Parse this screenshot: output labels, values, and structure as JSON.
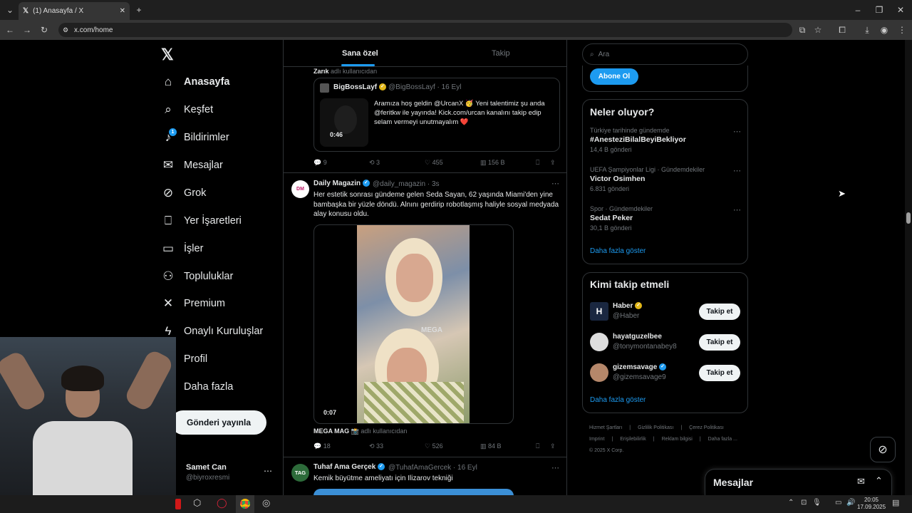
{
  "browser": {
    "tab_title": "(1) Anasayfa / X",
    "url": "x.com/home"
  },
  "sidebar": {
    "logo": "X",
    "items": [
      {
        "label": "Anasayfa",
        "icon": "home-icon",
        "glyph": "⌂"
      },
      {
        "label": "Keşfet",
        "icon": "search-icon",
        "glyph": "⌕"
      },
      {
        "label": "Bildirimler",
        "icon": "bell-icon",
        "glyph": "♪",
        "badge": "1"
      },
      {
        "label": "Mesajlar",
        "icon": "mail-icon",
        "glyph": "✉"
      },
      {
        "label": "Grok",
        "icon": "grok-icon",
        "glyph": "⊘"
      },
      {
        "label": "Yer İşaretleri",
        "icon": "bookmark-icon",
        "glyph": "⎕"
      },
      {
        "label": "İşler",
        "icon": "briefcase-icon",
        "glyph": "▭"
      },
      {
        "label": "Topluluklar",
        "icon": "communities-icon",
        "glyph": "⚇"
      },
      {
        "label": "Premium",
        "icon": "x-premium-icon",
        "glyph": "✕"
      },
      {
        "label": "Onaylı Kuruluşlar",
        "icon": "lightning-icon",
        "glyph": "ϟ"
      },
      {
        "label": "Profil",
        "icon": "profile-icon",
        "glyph": "☺"
      },
      {
        "label": "Daha fazla",
        "icon": "more-icon",
        "glyph": "⋯"
      }
    ],
    "post_button": "Gönderi yayınla",
    "account": {
      "name": "Samet Can",
      "handle": "@biyroxresmi"
    }
  },
  "feed": {
    "tabs": [
      "Sana özel",
      "Takip"
    ],
    "post1": {
      "context": "Zarık",
      "context_suffix": "adlı kullanıcıdan",
      "quote_name": "BigBossLayf",
      "quote_handle": "@BigBossLayf · 16 Eyl",
      "quote_text": "Aramıza hoş geldin @UrcanX 🥳 Yeni talentimiz şu anda @feritkw ile yayında! Kick.com/urcan kanalını takip edip selam vermeyi unutmayalım ❤️",
      "video_time": "0:46",
      "replies": "9",
      "reposts": "3",
      "likes": "455",
      "views": "156 B"
    },
    "post2": {
      "name": "Daily Magazin",
      "handle": "@daily_magazin · 3s",
      "text": "Her estetik sonrası gündeme gelen Seda Sayan, 62 yaşında Miami'den yine bambaşka bir yüzle döndü. Alnını gerdirip robotlaşmış haliyle sosyal medyada alay konusu oldu.",
      "video_time": "0:07",
      "video_watermark": "MEGA",
      "source": "MEGA MAG 📸",
      "source_suffix": "adlı kullanıcıdan",
      "replies": "18",
      "reposts": "33",
      "likes": "526",
      "views": "84 B"
    },
    "post3": {
      "name": "Tuhaf Ama Gerçek",
      "handle": "@TuhafAmaGercek · 16 Eyl",
      "text": "Kemik büyütme ameliyatı için Ilizarov tekniği",
      "avatar": "TAG"
    }
  },
  "right": {
    "search_placeholder": "Ara",
    "subscribe": "Abone Ol",
    "trends_title": "Neler oluyor?",
    "trends": [
      {
        "category": "Türkiye tarihinde gündemde",
        "name": "#AnesteziBilalBeyiBekliyor",
        "count": "14,4 B gönderi"
      },
      {
        "category": "UEFA Şampiyonlar Ligi · Gündemdekiler",
        "name": "Victor Osimhen",
        "count": "6.831 gönderi"
      },
      {
        "category": "Spor · Gündemdekiler",
        "name": "Sedat Peker",
        "count": "30,1 B gönderi"
      }
    ],
    "show_more": "Daha fazla göster",
    "who_title": "Kimi takip etmeli",
    "who": [
      {
        "name": "Haber",
        "handle": "@Haber",
        "verified": "gold",
        "button": "Takip et"
      },
      {
        "name": "hayatguzelbee",
        "handle": "@tonymontanabey8",
        "verified": "",
        "button": "Takip et"
      },
      {
        "name": "gizemsavage",
        "handle": "@gizemsavage9",
        "verified": "blue",
        "button": "Takip et"
      }
    ],
    "who_more": "Daha fazla göster",
    "footer1": [
      "Hizmet Şartları",
      "Gizlilik Politikası",
      "Çerez Politikası"
    ],
    "footer2": [
      "Imprint",
      "Erişilebilirlik",
      "Reklam bilgisi",
      "Daha fazla ..."
    ],
    "copyright": "© 2025 X Corp."
  },
  "messages_drawer": {
    "title": "Mesajlar"
  },
  "taskbar": {
    "time": "20:05",
    "date": "17.09.2025"
  },
  "colors": {
    "accent": "#1d9bf0",
    "bg": "#000000",
    "border": "#2f3336",
    "muted": "#71767b"
  }
}
